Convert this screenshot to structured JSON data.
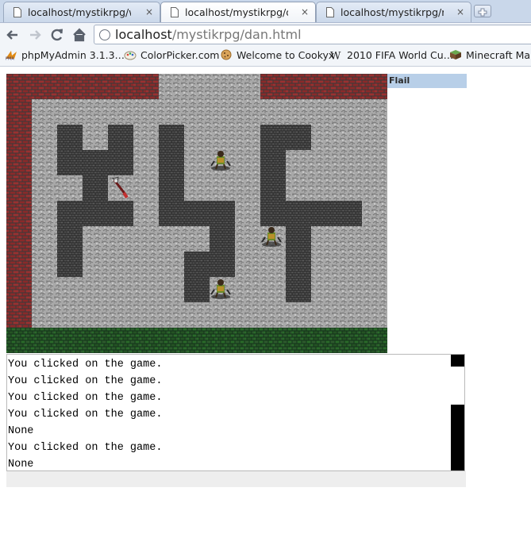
{
  "browser": {
    "tabs": [
      {
        "title": "localhost/mystikrpg/wek…",
        "active": false
      },
      {
        "title": "localhost/mystikrpg/dan.…",
        "active": true
      },
      {
        "title": "localhost/mystikrpg/red.…",
        "active": false
      }
    ],
    "close_glyph": "×",
    "address": {
      "host": "localhost",
      "path": "/mystikrpg/dan.html"
    },
    "bookmarks": [
      {
        "label": "phpMyAdmin 3.1.3.…",
        "icon": "pma-icon"
      },
      {
        "label": "ColorPicker.com",
        "icon": "colorpicker-icon"
      },
      {
        "label": "Welcome to Cookyx",
        "icon": "cookie-icon"
      },
      {
        "label": "2010 FIFA World Cu…",
        "icon": "wikipedia-icon"
      },
      {
        "label": "Minecraft Map",
        "icon": "minecraft-icon"
      }
    ]
  },
  "game": {
    "side_panel_title": "Flail"
  },
  "log": {
    "lines": [
      "You clicked on the game.",
      "You clicked on the game.",
      "You clicked on the game.",
      "You clicked on the game.",
      "None",
      "You clicked on the game.",
      "None"
    ]
  },
  "colors": {
    "brick": "#8a2a2a",
    "floor": "#a9a9a9",
    "wall": "#4a4a4a",
    "grass": "#1e4a1e"
  }
}
